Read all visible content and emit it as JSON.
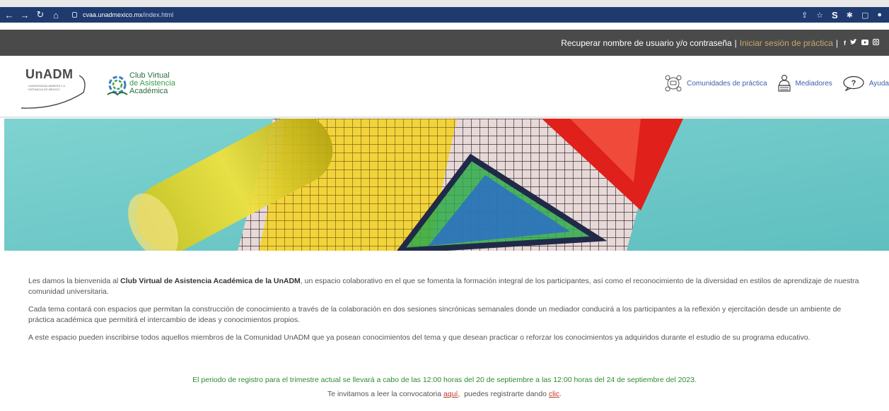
{
  "browser": {
    "url_host": "cvaa.unadmexico.mx",
    "url_path": "/index.html"
  },
  "topbar": {
    "recover_link": "Recuperar nombre de usuario y/o contraseña",
    "separator": "|",
    "practice_link": "Iniciar sesión de práctica"
  },
  "header": {
    "unadm_logo": "UnADM",
    "unadm_sub": "UNIVERSIDAD ABIERTA Y A DISTANCIA DE MÉXICO",
    "club_line1": "Club Virtual",
    "club_line2": "de Asistencia",
    "club_line3": "Académica",
    "nav": [
      {
        "label": "Comunidades de práctica"
      },
      {
        "label": "Mediadores"
      },
      {
        "label": "Ayuda"
      }
    ]
  },
  "content": {
    "p1_prefix": "Les damos la bienvenida al ",
    "p1_bold": "Club Virtual de Asistencia Académica de la UnADM",
    "p1_suffix": ", un espacio colaborativo en el que se fomenta la formación integral de los participantes, así como el reconocimiento de la diversidad en estilos de aprendizaje de nuestra comunidad universitaria.",
    "p2": "Cada tema contará con espacios que permitan la construcción de conocimiento a través de la colaboración en dos sesiones sincrónicas semanales donde un mediador conducirá a los participantes a la reflexión y ejercitación desde un ambiente de práctica académica que permitirá el intercambio de ideas y conocimientos propios.",
    "p3": "A este espacio pueden inscribirse todos aquellos miembros de la Comunidad UnADM que ya posean conocimientos del tema y que desean practicar o reforzar los conocimientos ya adquiridos durante el estudio de su programa educativo.",
    "notice": "El periodo de registro para el trimestre actual se llevará a cabo de las 12:00 horas del 20 de septiembre a las 12:00 horas del 24 de septiembre del 2023.",
    "invite_prefix": "Te invitamos a leer la convocatoria ",
    "invite_link1": "aquí",
    "invite_middle": ",  puedes registrarte dando ",
    "invite_link2": "clic",
    "invite_suffix": "."
  },
  "colors": {
    "chrome": "#1e3a6e",
    "topbar": "#4a4a4a",
    "practice_link": "#c9a86a",
    "nav_text": "#3e5fa8",
    "notice": "#2f8a2f",
    "link": "#c0392b"
  },
  "icons": [
    "back-arrow-icon",
    "forward-arrow-icon",
    "reload-icon",
    "home-icon",
    "lock-icon",
    "share-icon",
    "star-icon",
    "extension-icon",
    "puzzle-icon",
    "sidebar-icon",
    "profile-icon",
    "facebook-icon",
    "twitter-icon",
    "youtube-icon",
    "instagram-icon",
    "community-icon",
    "mediator-icon",
    "help-icon"
  ]
}
